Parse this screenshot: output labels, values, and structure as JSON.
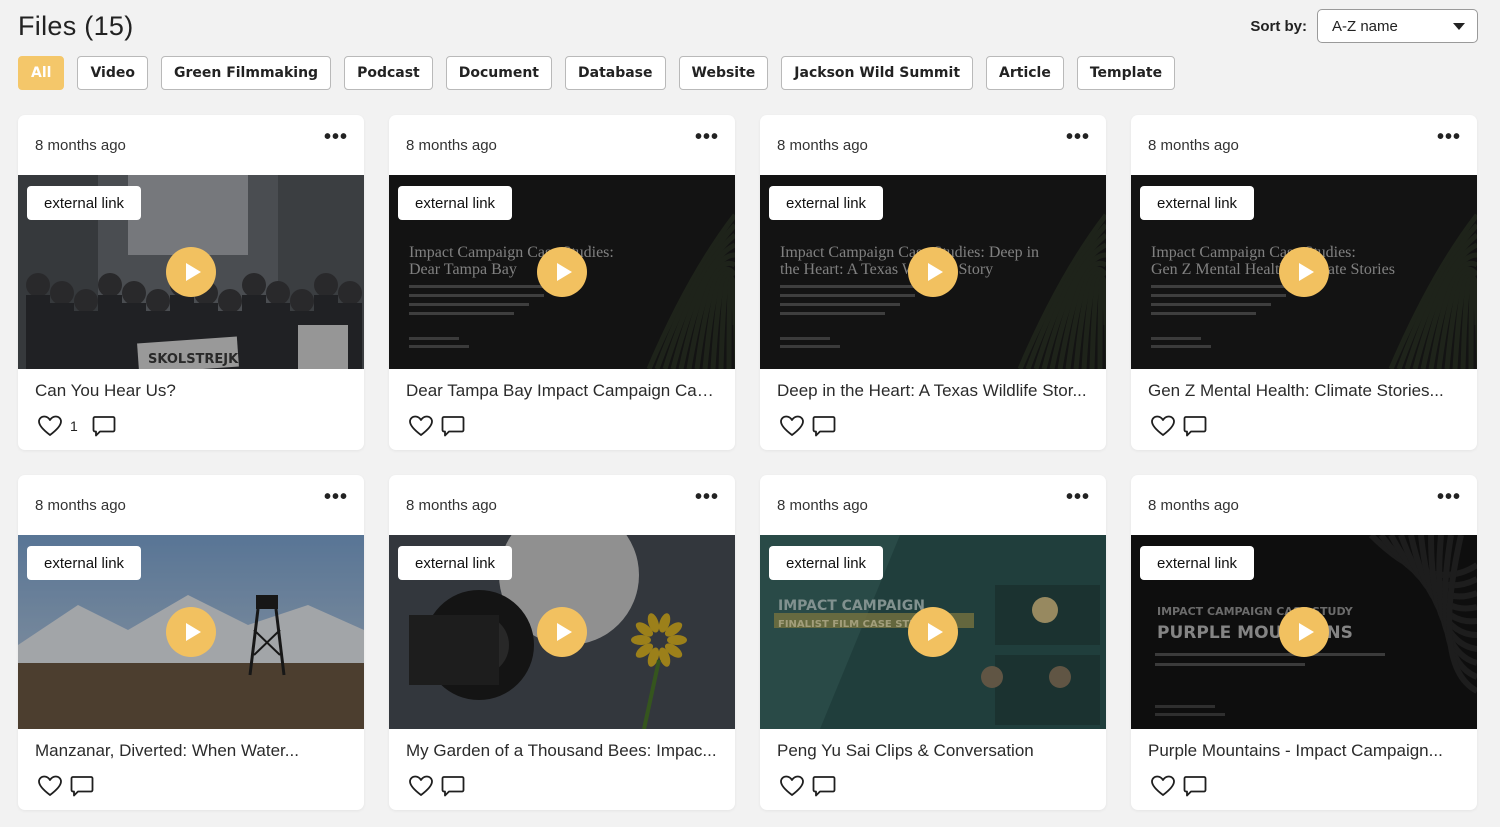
{
  "header": {
    "title": "Files (15)",
    "sort_label": "Sort by:",
    "sort_value": "A-Z name"
  },
  "filters": [
    "All",
    "Video",
    "Green Filmmaking",
    "Podcast",
    "Document",
    "Database",
    "Website",
    "Jackson Wild Summit",
    "Article",
    "Template"
  ],
  "active_filter": "All",
  "accent_color": "#f4c76a",
  "cards": [
    {
      "time": "8 months ago",
      "tag": "external link",
      "title": "Can You Hear Us?",
      "likes": "1",
      "thumb": "protest",
      "thumb_text": [
        "SKOLSTREJK"
      ]
    },
    {
      "time": "8 months ago",
      "tag": "external link",
      "title": "Dear Tampa Bay Impact Campaign Cas...",
      "likes": "",
      "thumb": "dark",
      "thumb_text": [
        "Impact Campaign Case Studies:",
        "Dear Tampa Bay"
      ]
    },
    {
      "time": "8 months ago",
      "tag": "external link",
      "title": "Deep in the Heart: A Texas Wildlife Stor...",
      "likes": "",
      "thumb": "dark",
      "thumb_text": [
        "Impact Campaign Case Studies: Deep in",
        "the Heart: A Texas Wildlife Story"
      ]
    },
    {
      "time": "8 months ago",
      "tag": "external link",
      "title": "Gen Z Mental Health: Climate Stories...",
      "likes": "",
      "thumb": "dark",
      "thumb_text": [
        "Impact Campaign Case Studies:",
        "Gen Z Mental Health: Climate Stories"
      ]
    },
    {
      "time": "8 months ago",
      "tag": "external link",
      "title": "Manzanar, Diverted: When Water...",
      "likes": "",
      "thumb": "desert",
      "thumb_text": []
    },
    {
      "time": "8 months ago",
      "tag": "external link",
      "title": "My Garden of a Thousand Bees: Impac...",
      "likes": "",
      "thumb": "camera",
      "thumb_text": []
    },
    {
      "time": "8 months ago",
      "tag": "external link",
      "title": "Peng Yu Sai Clips & Conversation",
      "likes": "",
      "thumb": "teal",
      "thumb_text": [
        "IMPACT CAMPAIGN",
        "FINALIST FILM CASE STUDIES"
      ]
    },
    {
      "time": "8 months ago",
      "tag": "external link",
      "title": "Purple Mountains - Impact Campaign...",
      "likes": "",
      "thumb": "purple",
      "thumb_text": [
        "IMPACT CAMPAIGN CASE STUDY",
        "PURPLE MOUNTAINS"
      ]
    }
  ]
}
